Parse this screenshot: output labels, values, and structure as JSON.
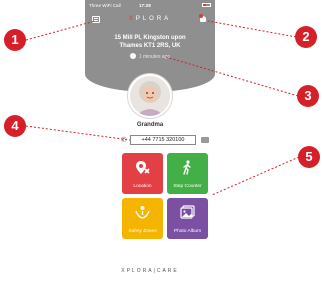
{
  "status_bar": {
    "carrier": "Three WiFi Call",
    "time": "17:28"
  },
  "header": {
    "logo": "XPLORA",
    "address_line1": "15 Mill Pl, Kingston upon",
    "address_line2": "Thames KT1 2RS, UK",
    "updated": "1 minutes ago"
  },
  "contact": {
    "name": "Grandma",
    "phone": "+44 7715 320100"
  },
  "tiles": [
    {
      "label": "Location",
      "color": "#e34046",
      "icon": "location-icon"
    },
    {
      "label": "Step Counter",
      "color": "#43b047",
      "icon": "walking-icon"
    },
    {
      "label": "Safety Zones",
      "color": "#f4b400",
      "icon": "safety-zones-icon"
    },
    {
      "label": "Photo Album",
      "color": "#7b4fa1",
      "icon": "photo-album-icon"
    }
  ],
  "footer": {
    "brand": "XPLORA|CARE"
  },
  "callouts": [
    "1",
    "2",
    "3",
    "4",
    "5"
  ]
}
